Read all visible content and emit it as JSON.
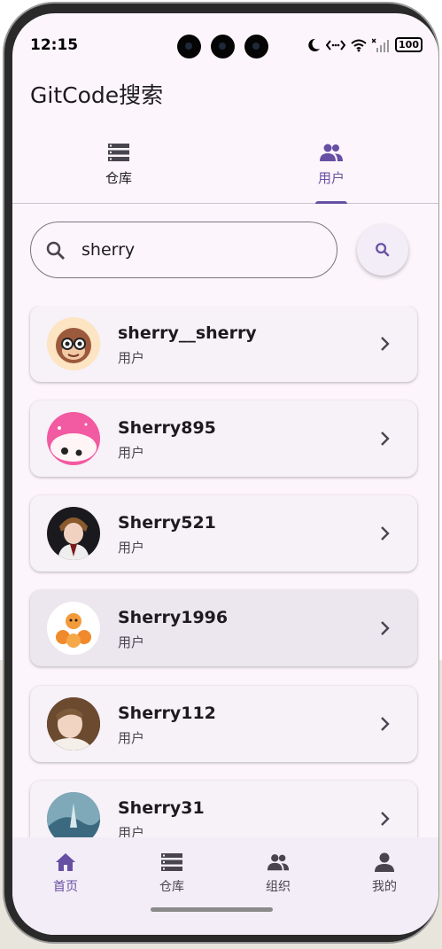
{
  "status": {
    "time": "12:15",
    "battery": "100"
  },
  "app": {
    "title": "GitCode搜索"
  },
  "tabs": [
    {
      "label": "仓库",
      "icon": "storage-icon",
      "active": false
    },
    {
      "label": "用户",
      "icon": "people-icon",
      "active": true
    }
  ],
  "search": {
    "value": "sherry",
    "placeholder": ""
  },
  "users": [
    {
      "name": "sherry__sherry",
      "type": "用户"
    },
    {
      "name": "Sherry895",
      "type": "用户"
    },
    {
      "name": "Sherry521",
      "type": "用户"
    },
    {
      "name": "Sherry1996",
      "type": "用户"
    },
    {
      "name": "Sherry112",
      "type": "用户"
    },
    {
      "name": "Sherry31",
      "type": "用户"
    }
  ],
  "bottom_nav": [
    {
      "label": "首页",
      "icon": "home-icon",
      "active": true
    },
    {
      "label": "仓库",
      "icon": "storage-icon",
      "active": false
    },
    {
      "label": "组织",
      "icon": "group-icon",
      "active": false
    },
    {
      "label": "我的",
      "icon": "person-icon",
      "active": false
    }
  ],
  "colors": {
    "accent": "#6750a4",
    "background": "#fcf5fb",
    "card": "#f7f1f8"
  }
}
